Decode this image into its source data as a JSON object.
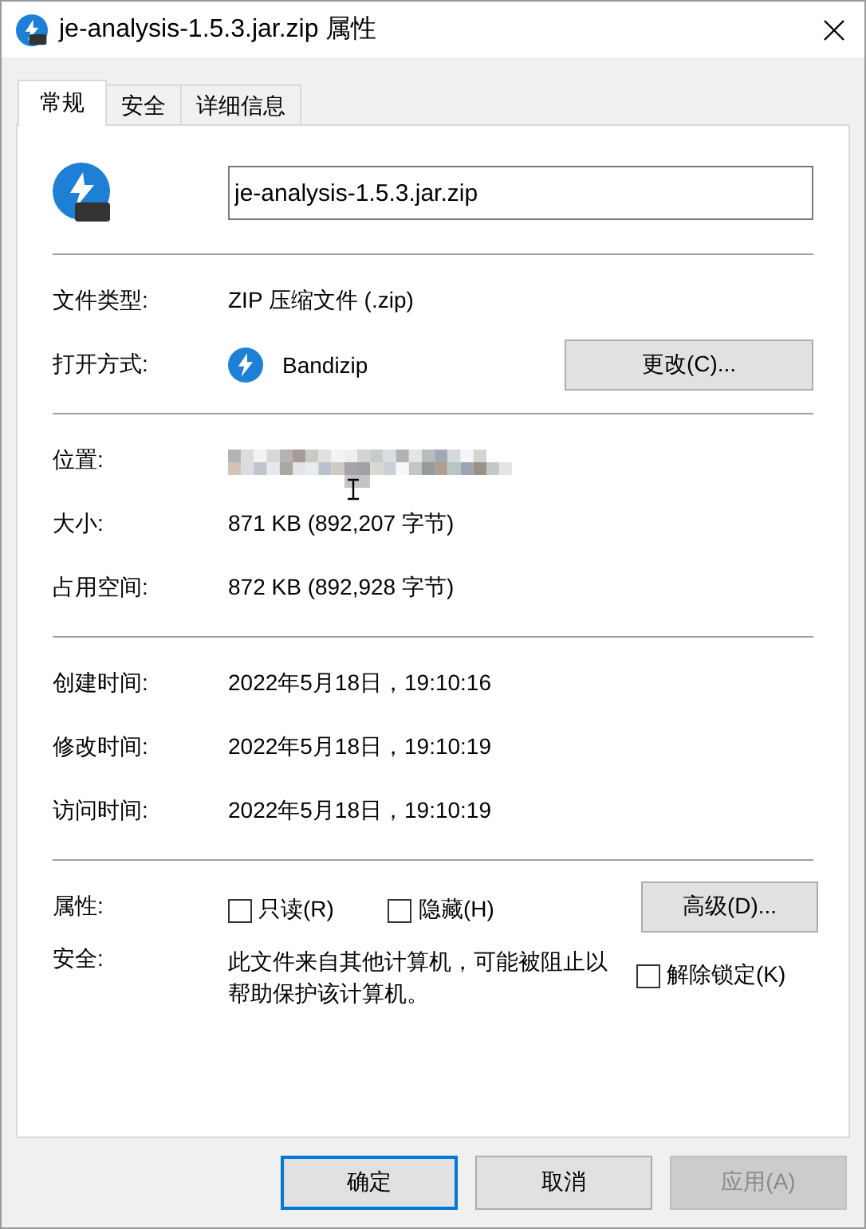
{
  "window": {
    "title": "je-analysis-1.5.3.jar.zip 属性"
  },
  "tabs": [
    {
      "label": "常规",
      "selected": true
    },
    {
      "label": "安全",
      "selected": false
    },
    {
      "label": "详细信息",
      "selected": false
    }
  ],
  "file": {
    "name": "je-analysis-1.5.3.jar.zip"
  },
  "type_row": {
    "label": "文件类型:",
    "value": "ZIP 压缩文件 (.zip)"
  },
  "open_with": {
    "label": "打开方式:",
    "app": "Bandizip",
    "button": "更改(C)..."
  },
  "location": {
    "label": "位置:"
  },
  "sizes": [
    {
      "label": "大小:",
      "value": "871 KB (892,207 字节)"
    },
    {
      "label": "占用空间:",
      "value": "872 KB (892,928 字节)"
    }
  ],
  "times": [
    {
      "label": "创建时间:",
      "value": "2022年5月18日，19:10:16"
    },
    {
      "label": "修改时间:",
      "value": "2022年5月18日，19:10:19"
    },
    {
      "label": "访问时间:",
      "value": "2022年5月18日，19:10:19"
    }
  ],
  "attributes": {
    "label": "属性:",
    "checkboxes": [
      {
        "label": "只读(R)",
        "checked": false
      },
      {
        "label": "隐藏(H)",
        "checked": false
      }
    ],
    "button": "高级(D)..."
  },
  "security": {
    "label": "安全:",
    "text": "此文件来自其他计算机，可能被阻止以帮助保护该计算机。",
    "checkbox": {
      "label": "解除锁定(K)",
      "checked": false
    }
  },
  "buttons": [
    {
      "label": "确定",
      "kind": "default",
      "disabled": false
    },
    {
      "label": "取消",
      "kind": "normal",
      "disabled": false
    },
    {
      "label": "应用(A)",
      "kind": "normal",
      "disabled": true
    }
  ]
}
